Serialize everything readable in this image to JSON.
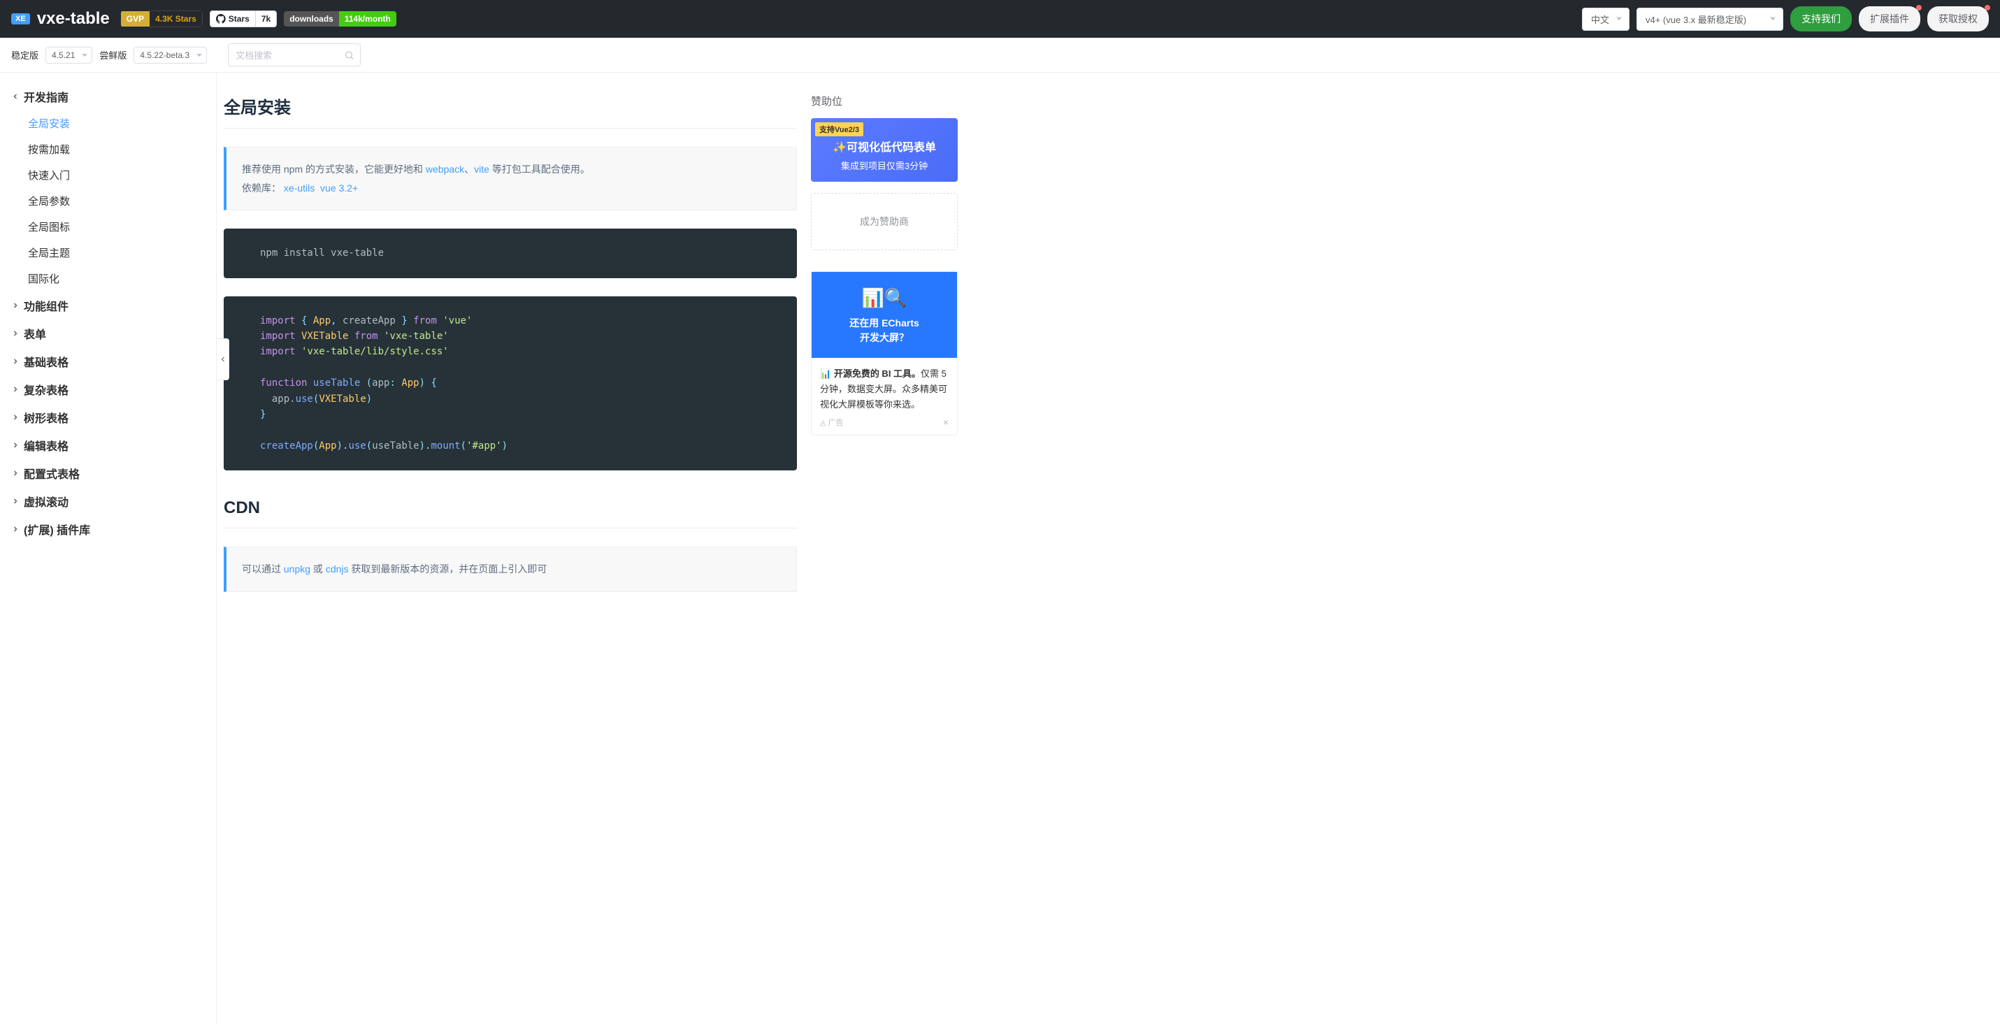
{
  "brand": "vxe-table",
  "badges": {
    "gvp_l": "GVP",
    "gvp_r": "4.3K Stars",
    "gh_l": "Stars",
    "gh_r": "7k",
    "dl_l": "downloads",
    "dl_r": "114k/month"
  },
  "topbar": {
    "lang": "中文",
    "ver": "v4+ (vue 3.x 最新稳定版)",
    "support": "支持我们",
    "plugin": "扩展插件",
    "auth": "获取授权"
  },
  "subbar": {
    "stable_lbl": "稳定版",
    "stable_val": "4.5.21",
    "beta_lbl": "尝鲜版",
    "beta_val": "4.5.22-beta.3",
    "search_ph": "文档搜索"
  },
  "menu": {
    "guide": "开发指南",
    "guide_items": [
      "全局安装",
      "按需加载",
      "快速入门",
      "全局参数",
      "全局图标",
      "全局主题",
      "国际化"
    ],
    "groups": [
      "功能组件",
      "表单",
      "基础表格",
      "复杂表格",
      "树形表格",
      "编辑表格",
      "配置式表格",
      "虚拟滚动",
      "(扩展) 插件库"
    ]
  },
  "page": {
    "h1": "全局安装",
    "tip1_a": "推荐使用 npm 的方式安装，它能更好地和 ",
    "tip1_link1": "webpack",
    "tip1_b": "、",
    "tip1_link2": "vite",
    "tip1_c": " 等打包工具配合使用。",
    "tip2_a": "依赖库： ",
    "tip2_link3": "xe-utils",
    "tip2_link4": "vue 3.2+",
    "code1": "npm install vxe-table",
    "h2": "CDN",
    "tip3_a": "可以通过 ",
    "tip3_link1": "unpkg",
    "tip3_b": " 或 ",
    "tip3_link2": "cdnjs",
    "tip3_c": " 获取到最新版本的资源，并在页面上引入即可"
  },
  "code2": {
    "l1a": "import",
    "l1b": " { ",
    "l1c": "App",
    "l1d": ", ",
    "l1e": "createApp",
    "l1f": " } ",
    "l1g": "from",
    "l1h": " 'vue'",
    "l2a": "import",
    "l2b": " VXETable ",
    "l2c": "from",
    "l2d": " 'vxe-table'",
    "l3a": "import",
    "l3b": " 'vxe-table/lib/style.css'",
    "l5a": "function",
    "l5b": " useTable ",
    "l5c": "(",
    "l5d": "app",
    "l5e": ": ",
    "l5f": "App",
    "l5g": ") {",
    "l6a": "  app.",
    "l6b": "use",
    "l6c": "(",
    "l6d": "VXETable",
    "l6e": ")",
    "l7": "}",
    "l9a": "createApp",
    "l9b": "(",
    "l9c": "App",
    "l9d": ").",
    "l9e": "use",
    "l9f": "(",
    "l9g": "useTable",
    "l9h": ").",
    "l9i": "mount",
    "l9j": "(",
    "l9k": "'#app'",
    "l9l": ")"
  },
  "aside": {
    "title": "赞助位",
    "sp_tag": "支持Vue2/3",
    "sp_t1": "✨可视化低代码表单",
    "sp_t2": "集成到项目仅需3分钟",
    "become": "成为赞助商",
    "ad_img1": "还在用 ECharts",
    "ad_img2": "开发大屏？",
    "ad_b": "开源免费的 BI 工具。",
    "ad_txt": "仅需 5 分钟，数据变大屏。众多精美可视化大屏模板等你来选。",
    "ad_mark": "广告"
  }
}
